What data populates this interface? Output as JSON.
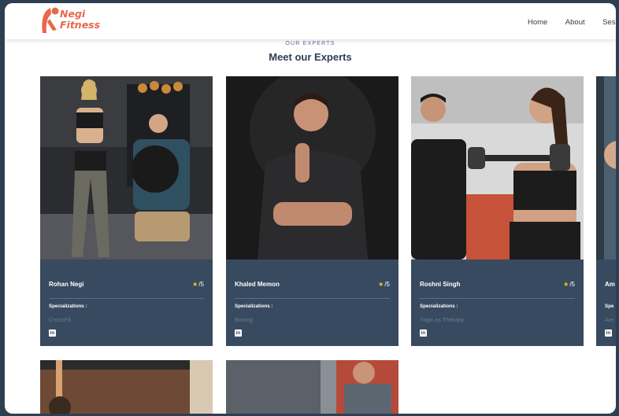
{
  "brand": {
    "line1": "Negi",
    "line2": "Fitness"
  },
  "nav": {
    "home": "Home",
    "about": "About",
    "sessions": "Sess"
  },
  "section": {
    "kicker": "OUR EXPERTS",
    "title": "Meet our Experts"
  },
  "specializations_label": "Specializations :",
  "colors": {
    "accent": "#e7684a",
    "card_bg": "#384a5f",
    "page_frame": "#2f3f52",
    "star": "#f5c518"
  },
  "experts": [
    {
      "name": "Rohan Negi",
      "rating": "/5",
      "spec_label": "Specializations :",
      "specialization": "CrossFit",
      "icon": "linkedin-icon"
    },
    {
      "name": "Khaled Memon",
      "rating": "/5",
      "spec_label": "Specializations :",
      "specialization": "Boxing",
      "icon": "linkedin-icon"
    },
    {
      "name": "Roshni Singh",
      "rating": "/5",
      "spec_label": "Specializations :",
      "specialization": "Yoga as Therapy",
      "icon": "linkedin-icon"
    },
    {
      "name": "Am",
      "rating": "",
      "spec_label": "Spe",
      "specialization": "Aer",
      "icon": "linkedin-icon"
    }
  ]
}
